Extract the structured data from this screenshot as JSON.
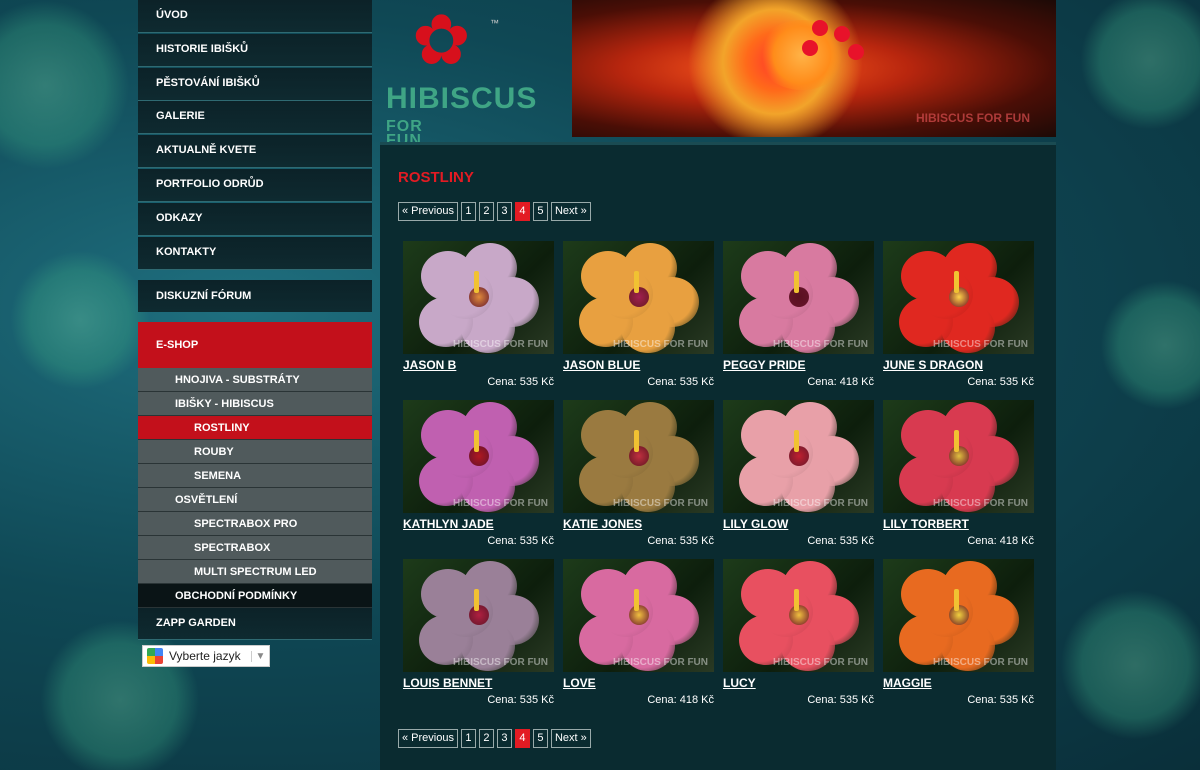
{
  "nav": {
    "items": [
      {
        "label": "ÚVOD"
      },
      {
        "label": "HISTORIE IBIŠKŮ"
      },
      {
        "label": "PĚSTOVÁNÍ IBIŠKŮ"
      },
      {
        "label": "GALERIE"
      },
      {
        "label": "AKTUALNĚ KVETE"
      },
      {
        "label": "PORTFOLIO ODRŮD"
      },
      {
        "label": "ODKAZY"
      },
      {
        "label": "KONTAKTY"
      }
    ],
    "forum": "DISKUZNÍ FÓRUM",
    "eshop": "E-SHOP",
    "eshop_sub": [
      {
        "label": "HNOJIVA - SUBSTRÁTY",
        "level": 1,
        "active": false
      },
      {
        "label": "IBIŠKY - HIBISCUS",
        "level": 1,
        "active": false
      },
      {
        "label": "ROSTLINY",
        "level": 2,
        "active": true
      },
      {
        "label": "ROUBY",
        "level": 2,
        "active": false
      },
      {
        "label": "SEMENA",
        "level": 2,
        "active": false
      },
      {
        "label": "OSVĚTLENÍ",
        "level": 1,
        "active": false
      },
      {
        "label": "SPECTRABOX PRO",
        "level": 2,
        "active": false
      },
      {
        "label": "SPECTRABOX",
        "level": 2,
        "active": false
      },
      {
        "label": "MULTI SPECTRUM LED",
        "level": 2,
        "active": false
      },
      {
        "label": "OBCHODNÍ PODMÍNKY",
        "level": 1,
        "active": false
      }
    ],
    "zapp": "ZAPP GARDEN",
    "translate_label": "Vyberte jazyk"
  },
  "logo": {
    "tm": "™",
    "text_main": "HIBISCUS",
    "text_for": "FOR",
    "text_fun": "FUN"
  },
  "banner": {
    "watermark": "HIBISCUS FOR FUN"
  },
  "main": {
    "title": "ROSTLINY",
    "pager": {
      "prev": "« Previous",
      "pages": [
        "1",
        "2",
        "3",
        "4",
        "5"
      ],
      "current": "4",
      "next": "Next »"
    },
    "watermark": "HIBISCUS FOR FUN",
    "products": [
      {
        "name": "JASON B",
        "price": "Cena: 535 Kč",
        "color": "#c8a8c8",
        "center": "#e08a3a"
      },
      {
        "name": "JASON BLUE",
        "price": "Cena: 535 Kč",
        "color": "#e8a040",
        "center": "#a02050"
      },
      {
        "name": "PEGGY PRIDE",
        "price": "Cena: 418 Kč",
        "color": "#d87aa0",
        "center": "#5a1020"
      },
      {
        "name": "JUNE S DRAGON",
        "price": "Cena: 535 Kč",
        "color": "#e02820",
        "center": "#ffd34a"
      },
      {
        "name": "KATHLYN JADE",
        "price": "Cena: 535 Kč",
        "color": "#c060b0",
        "center": "#b01820"
      },
      {
        "name": "KATIE JONES",
        "price": "Cena: 535 Kč",
        "color": "#9a7a40",
        "center": "#c03040"
      },
      {
        "name": "LILY GLOW",
        "price": "Cena: 535 Kč",
        "color": "#e8a0a8",
        "center": "#c02030"
      },
      {
        "name": "LILY TORBERT",
        "price": "Cena: 418 Kč",
        "color": "#d83a50",
        "center": "#e0c040"
      },
      {
        "name": "LOUIS BENNET",
        "price": "Cena: 535 Kč",
        "color": "#9a8098",
        "center": "#b02040"
      },
      {
        "name": "LOVE",
        "price": "Cena: 418 Kč",
        "color": "#d86aa0",
        "center": "#f0c040"
      },
      {
        "name": "LUCY",
        "price": "Cena: 535 Kč",
        "color": "#e85060",
        "center": "#f0c040"
      },
      {
        "name": "MAGGIE",
        "price": "Cena: 535 Kč",
        "color": "#e86a20",
        "center": "#f0d040"
      }
    ]
  }
}
